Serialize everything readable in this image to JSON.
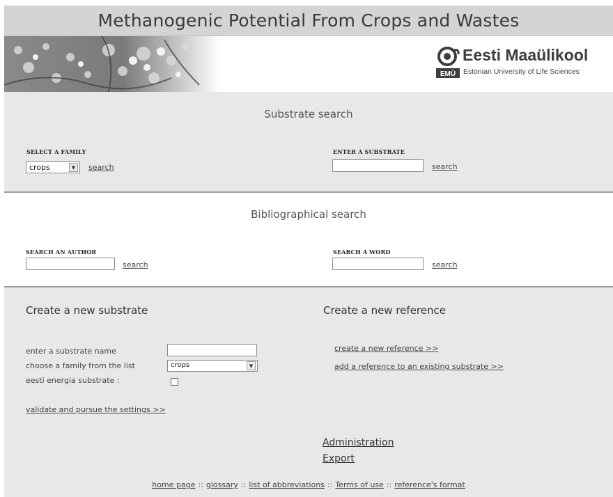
{
  "header": {
    "title": "Methanogenic Potential From Crops and Wastes"
  },
  "logo": {
    "name": "Eesti Maaülikool",
    "subtitle": "Estonian University of Life Sciences",
    "mark_text": "EMÜ"
  },
  "substrate_search": {
    "title": "Substrate search",
    "family_label": "SELECT A FAMILY",
    "family_selected": "crops",
    "family_search_link": "search",
    "substrate_label": "ENTER A SUBSTRATE",
    "substrate_value": "",
    "substrate_search_link": "search"
  },
  "bibliographical_search": {
    "title": "Bibliographical search",
    "author_label": "SEARCH AN AUTHOR",
    "author_value": "",
    "author_search_link": "search",
    "word_label": "SEARCH A WORD",
    "word_value": "",
    "word_search_link": "search"
  },
  "create_substrate": {
    "title": "Create a new substrate",
    "name_label": "enter a substrate name",
    "name_value": "",
    "family_label": "choose a family from the list",
    "family_selected": "crops",
    "eesti_label": "eesti energia substrate :",
    "eesti_checked": false,
    "validate_link": "validate and pursue the settings >>"
  },
  "create_reference": {
    "title": "Create a new reference",
    "new_reference_link": "create a new reference >>",
    "add_reference_link": "add a reference to an existing substrate >>"
  },
  "admin": {
    "administration_link": "Administration",
    "export_link": "Export"
  },
  "footer": {
    "links": [
      "home page",
      "glossary",
      "list of abbreviations",
      "Terms of use",
      "reference's format"
    ],
    "separator": "::"
  },
  "colors": {
    "title_bar": "#d4d4d4",
    "section_gray": "#e8e8e8",
    "divider": "#9e9e9e"
  }
}
